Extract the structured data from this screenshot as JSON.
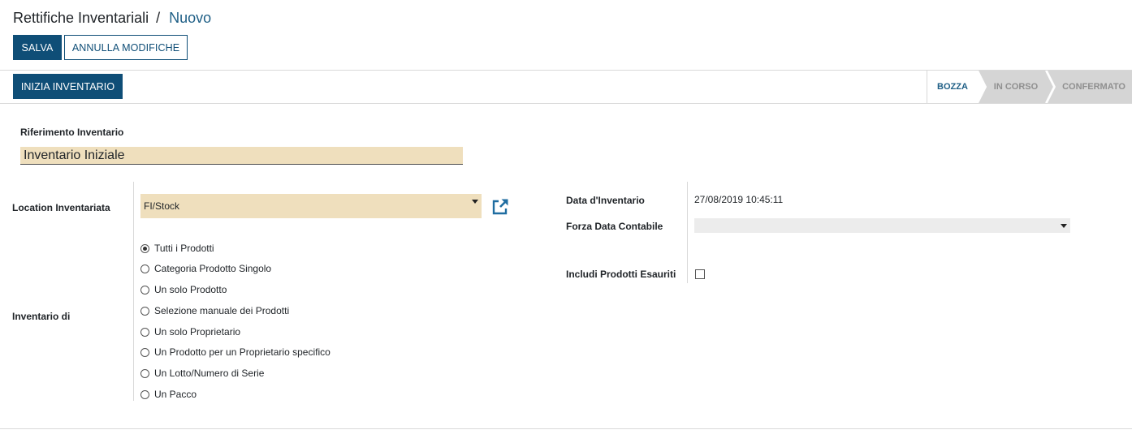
{
  "breadcrumb": {
    "parent": "Rettifiche Inventariali",
    "separator": "/",
    "current": "Nuovo"
  },
  "toolbar": {
    "save_label": "SALVA",
    "discard_label": "ANNULLA MODIFICHE"
  },
  "header": {
    "start_inventory_label": "INIZIA INVENTARIO",
    "stages": [
      {
        "label": "BOZZA",
        "active": true
      },
      {
        "label": "IN CORSO",
        "active": false
      },
      {
        "label": "CONFERMATO",
        "active": false
      }
    ]
  },
  "form": {
    "reference_label": "Riferimento Inventario",
    "reference_value": "Inventario Iniziale",
    "location_label": "Location Inventariata",
    "location_value": "FI/Stock",
    "inventory_of_label": "Inventario di",
    "inventory_options": [
      {
        "label": "Tutti i Prodotti",
        "checked": true
      },
      {
        "label": "Categoria Prodotto Singolo",
        "checked": false
      },
      {
        "label": "Un solo Prodotto",
        "checked": false
      },
      {
        "label": "Selezione manuale dei Prodotti",
        "checked": false
      },
      {
        "label": "Un solo Proprietario",
        "checked": false
      },
      {
        "label": "Un Prodotto per un Proprietario specifico",
        "checked": false
      },
      {
        "label": "Un Lotto/Numero di Serie",
        "checked": false
      },
      {
        "label": "Un Pacco",
        "checked": false
      }
    ],
    "date_label": "Data d'Inventario",
    "date_value": "27/08/2019 10:45:11",
    "accounting_date_label": "Forza Data Contabile",
    "accounting_date_value": "",
    "include_exhausted_label": "Includi Prodotti Esauriti",
    "include_exhausted_checked": false
  },
  "colors": {
    "primary": "#0f4e77",
    "link": "#1f5f86",
    "required_field": "#efdfbd",
    "inactive_stage": "#d5d5d5"
  },
  "icons": {
    "external_link": "external-link-icon",
    "dropdown": "caret-down-icon"
  }
}
